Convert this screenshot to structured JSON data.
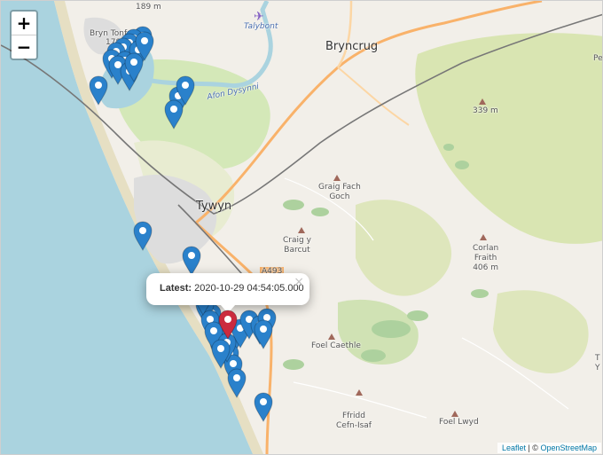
{
  "zoom": {
    "in_label": "+",
    "out_label": "−"
  },
  "places": {
    "bryn_tonfanau": "Bryn Tonfanau",
    "bryn_tonfanau_height": "178 m",
    "summit_189": "189 m",
    "talybont": "Talybont",
    "bryncrug": "Bryncrug",
    "afon_dysynni": "Afon Dysynni",
    "height_339": "339 m",
    "graig_fach_goch_1": "Graig Fach",
    "graig_fach_goch_2": "Goch",
    "tywyn": "Tywyn",
    "craig_y_barcut_1": "Craig y",
    "craig_y_barcut_2": "Barcut",
    "corlan_fraith_1": "Corlan",
    "corlan_fraith_2": "Fraith",
    "corlan_fraith_height": "406 m",
    "road_a493": "A493",
    "foel_caethle": "Foel Caethle",
    "ffridd_cefn_isaf_1": "Ffridd",
    "ffridd_cefn_isaf_2": "Cefn-Isaf",
    "foel_lwyd": "Foel Lwyd",
    "edge_pe": "Pe",
    "edge_ty_1": "T",
    "edge_ty_2": "Y"
  },
  "popup": {
    "label": "Latest:",
    "value": "2020-10-29 04:54:05.000",
    "close": "×"
  },
  "markers": {
    "blue_color": "#2a81cb",
    "red_color": "#cb2b3e",
    "count_blue": 40,
    "count_red": 1
  },
  "attribution": {
    "leaflet": "Leaflet",
    "separator": " | © ",
    "osm": "OpenStreetMap"
  }
}
